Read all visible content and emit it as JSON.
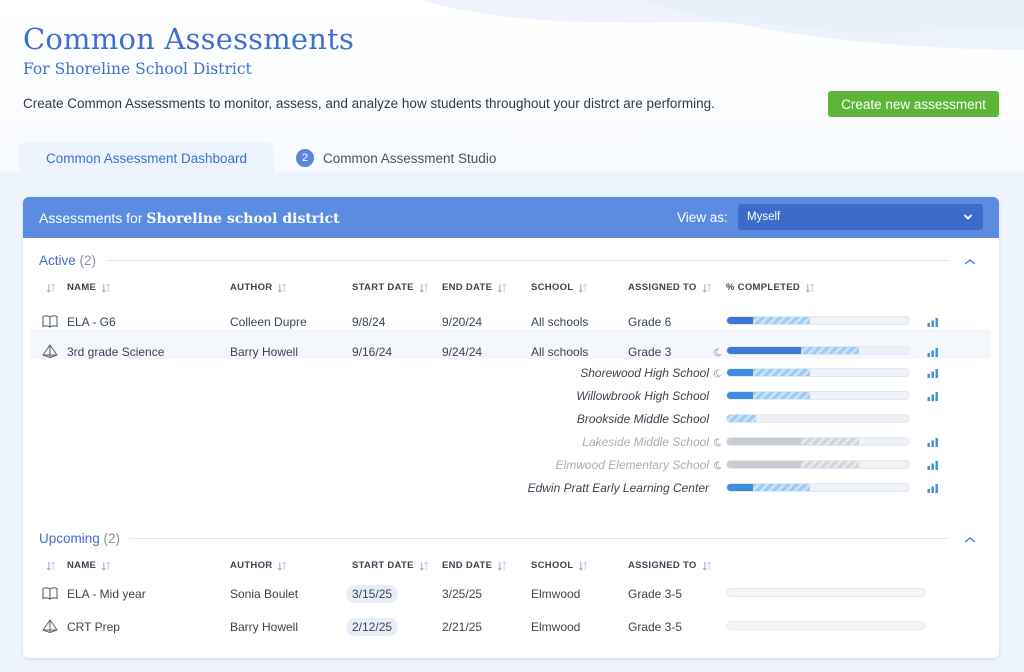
{
  "page": {
    "title": "Common Assessments",
    "subtitle": "For Shoreline School District",
    "description": "Create Common Assessments to monitor, assess, and analyze how students throughout your distrct are performing.",
    "create_button": "Create new assessment"
  },
  "tabs": [
    {
      "label": "Common Assessment Dashboard",
      "active": true
    },
    {
      "label": "Common Assessment Studio",
      "badge": "2",
      "active": false
    }
  ],
  "panel": {
    "title_prefix": "Assessments for ",
    "title_bold": "Shoreline school district",
    "view_as_label": "View as:",
    "view_as_value": "Myself"
  },
  "columns": {
    "name": "NAME",
    "author": "AUTHOR",
    "start_date": "START DATE",
    "end_date": "END DATE",
    "school": "SCHOOL",
    "assigned_to": "ASSIGNED TO",
    "completed": "% COMPLETED"
  },
  "active": {
    "label": "Active",
    "count": "(2)",
    "rows": [
      {
        "icon": "book-icon",
        "name": "ELA - G6",
        "author": "Colleen Dupre",
        "start": "9/8/24",
        "end": "9/20/24",
        "school": "All schools",
        "assigned": "Grade 6",
        "progress_solid": 0.14,
        "progress_partial": 0.45
      },
      {
        "icon": "pyramid-icon",
        "name": "3rd grade Science",
        "author": "Barry Howell",
        "start": "9/16/24",
        "end": "9/24/24",
        "school": "All schools",
        "assigned": "Grade 3",
        "progress_solid": 0.4,
        "progress_partial": 0.72
      }
    ],
    "schools": [
      {
        "name": "Shorewood High School",
        "muted": false,
        "moon": true,
        "stats": true,
        "progress_solid": 0.14,
        "progress_partial": 0.45,
        "gray": false
      },
      {
        "name": "Willowbrook High School",
        "muted": false,
        "moon": false,
        "stats": true,
        "progress_solid": 0.14,
        "progress_partial": 0.45,
        "gray": false
      },
      {
        "name": "Brookside Middle School",
        "muted": false,
        "moon": false,
        "stats": false,
        "progress_solid": 0.0,
        "progress_partial": 0.16,
        "gray": false
      },
      {
        "name": "Lakeside Middle School",
        "muted": true,
        "moon": true,
        "stats": true,
        "progress_solid": 0.4,
        "progress_partial": 0.72,
        "gray": true
      },
      {
        "name": "Elmwood Elementary School",
        "muted": true,
        "moon": true,
        "stats": true,
        "progress_solid": 0.4,
        "progress_partial": 0.72,
        "gray": true
      },
      {
        "name": "Edwin Pratt Early Learning Center",
        "muted": false,
        "moon": false,
        "stats": true,
        "progress_solid": 0.14,
        "progress_partial": 0.45,
        "gray": false
      }
    ]
  },
  "upcoming": {
    "label": "Upcoming",
    "count": "(2)",
    "rows": [
      {
        "icon": "book-icon",
        "name": "ELA - Mid year",
        "author": "Sonia Boulet",
        "start": "3/15/25",
        "end": "3/25/25",
        "school": "Elmwood",
        "assigned": "Grade 3-5"
      },
      {
        "icon": "pyramid-icon",
        "name": "CRT Prep",
        "author": "Barry Howell",
        "start": "2/12/25",
        "end": "2/21/25",
        "school": "Elmwood",
        "assigned": "Grade 3-5"
      }
    ]
  },
  "colors": {
    "accent": "#3f6fd1",
    "header": "#5b8ce2",
    "create": "#5cb536",
    "progress_solid": "#3f78d8",
    "progress_small": "#3a8fe0"
  }
}
